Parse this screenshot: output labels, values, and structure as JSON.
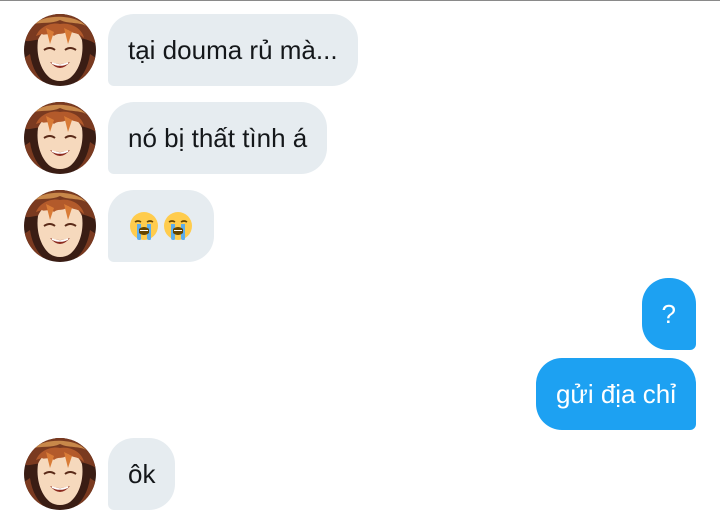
{
  "conversation": {
    "messages": [
      {
        "sender": "them",
        "text": "tại douma rủ mà..."
      },
      {
        "sender": "them",
        "text": "nó bị thất tình á"
      },
      {
        "sender": "them",
        "emoji": [
          "loudly-crying-face",
          "loudly-crying-face"
        ]
      },
      {
        "sender": "me",
        "text": "?"
      },
      {
        "sender": "me",
        "text": "gửi địa chỉ"
      },
      {
        "sender": "them",
        "text": "ôk"
      }
    ]
  },
  "colors": {
    "incoming_bubble": "#e6ecf0",
    "outgoing_bubble": "#1da1f2",
    "incoming_text": "#14171a",
    "outgoing_text": "#ffffff"
  }
}
